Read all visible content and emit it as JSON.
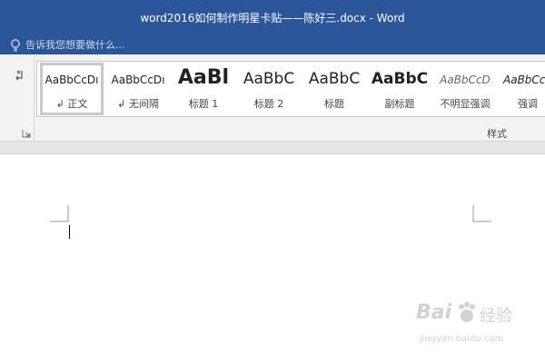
{
  "window": {
    "title": "word2016如何制作明星卡贴——陈好三.docx - Word"
  },
  "tell_me": {
    "placeholder": "告诉我您想要做什么..."
  },
  "styles": {
    "group_label": "样式",
    "items": [
      {
        "sample": "AaBbCcDı",
        "name": "↲ 正文"
      },
      {
        "sample": "AaBbCcDı",
        "name": "↲ 无间隔"
      },
      {
        "sample": "AaBl",
        "name": "标题 1"
      },
      {
        "sample": "AaBbC",
        "name": "标题 2"
      },
      {
        "sample": "AaBbC",
        "name": "标题"
      },
      {
        "sample": "AaBbC",
        "name": "副标题"
      },
      {
        "sample": "AaBbCcD",
        "name": "不明显强调"
      },
      {
        "sample": "AaBbCc",
        "name": "强调"
      }
    ]
  },
  "watermark": {
    "brand": "Bai",
    "suffix": "经验",
    "url": "jingyan.baidu.com"
  },
  "colors": {
    "title_bar": "#2b579a",
    "ribbon": "#f3f3f3"
  }
}
